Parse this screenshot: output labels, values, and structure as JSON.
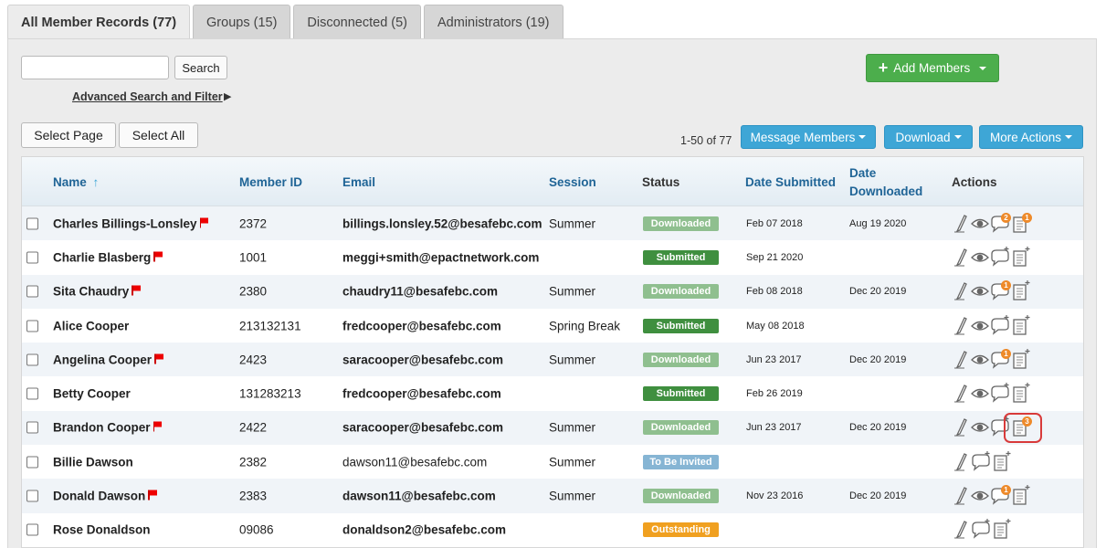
{
  "tabs": [
    {
      "label": "All Member Records (77)",
      "active": true
    },
    {
      "label": "Groups (15)",
      "active": false
    },
    {
      "label": "Disconnected (5)",
      "active": false
    },
    {
      "label": "Administrators (19)",
      "active": false
    }
  ],
  "search": {
    "value": "",
    "placeholder": "",
    "button_label": "Search",
    "advanced_link": "Advanced Search and Filter",
    "advanced_arrow": "▶"
  },
  "toolbar": {
    "add_members_label": "Add Members",
    "select_page_label": "Select Page",
    "select_all_label": "Select All",
    "count_text": "1-50 of 77",
    "message_members_label": "Message Members",
    "download_label": "Download",
    "more_actions_label": "More Actions"
  },
  "columns": {
    "name": "Name",
    "sort_arrow": "↑",
    "member_id": "Member ID",
    "email": "Email",
    "session": "Session",
    "status": "Status",
    "date_submitted": "Date Submitted",
    "date_downloaded_1": "Date",
    "date_downloaded_2": "Downloaded",
    "actions": "Actions"
  },
  "status_colors": {
    "Downloaded": "#8fbf8f",
    "Submitted": "#3f8f3f",
    "To Be Invited": "#86b5d4",
    "Outstanding": "#f0a020"
  },
  "rows": [
    {
      "name": "Charles Billings-Lonsley",
      "flag": true,
      "member_id": "2372",
      "email": "billings.lonsley.52@besafebc.com",
      "email_bold": true,
      "session": "Summer",
      "status": "Downloaded",
      "date_submitted": "Feb 07 2018",
      "date_downloaded": "Aug 19 2020",
      "view_icon": true,
      "msg_count": "2",
      "form_count": "1"
    },
    {
      "name": "Charlie Blasberg",
      "flag": true,
      "member_id": "1001",
      "email": "meggi+smith@epactnetwork.com",
      "email_bold": true,
      "session": "",
      "status": "Submitted",
      "date_submitted": "Sep 21 2020",
      "date_downloaded": "",
      "view_icon": true,
      "msg_count": "",
      "form_count": ""
    },
    {
      "name": "Sita Chaudry",
      "flag": true,
      "member_id": "2380",
      "email": "chaudry11@besafebc.com",
      "email_bold": true,
      "session": "Summer",
      "status": "Downloaded",
      "date_submitted": "Feb 08 2018",
      "date_downloaded": "Dec 20 2019",
      "view_icon": true,
      "msg_count": "1",
      "form_count": ""
    },
    {
      "name": "Alice Cooper",
      "flag": false,
      "member_id": "213132131",
      "email": "fredcooper@besafebc.com",
      "email_bold": true,
      "session": "Spring Break",
      "status": "Submitted",
      "date_submitted": "May 08 2018",
      "date_downloaded": "",
      "view_icon": true,
      "msg_count": "",
      "form_count": ""
    },
    {
      "name": "Angelina Cooper",
      "flag": true,
      "member_id": "2423",
      "email": "saracooper@besafebc.com",
      "email_bold": true,
      "session": "Summer",
      "status": "Downloaded",
      "date_submitted": "Jun 23 2017",
      "date_downloaded": "Dec 20 2019",
      "view_icon": true,
      "msg_count": "1",
      "form_count": ""
    },
    {
      "name": "Betty Cooper",
      "flag": false,
      "member_id": "131283213",
      "email": "fredcooper@besafebc.com",
      "email_bold": true,
      "session": "",
      "status": "Submitted",
      "date_submitted": "Feb 26 2019",
      "date_downloaded": "",
      "view_icon": true,
      "msg_count": "",
      "form_count": ""
    },
    {
      "name": "Brandon Cooper",
      "flag": true,
      "member_id": "2422",
      "email": "saracooper@besafebc.com",
      "email_bold": true,
      "session": "Summer",
      "status": "Downloaded",
      "date_submitted": "Jun 23 2017",
      "date_downloaded": "Dec 20 2019",
      "view_icon": true,
      "msg_count": "",
      "form_count": "3",
      "highlight": true
    },
    {
      "name": "Billie Dawson",
      "flag": false,
      "member_id": "2382",
      "email": "dawson11@besafebc.com",
      "email_bold": false,
      "session": "Summer",
      "status": "To Be Invited",
      "date_submitted": "",
      "date_downloaded": "",
      "view_icon": false,
      "msg_count": "",
      "form_count": ""
    },
    {
      "name": "Donald Dawson",
      "flag": true,
      "member_id": "2383",
      "email": "dawson11@besafebc.com",
      "email_bold": true,
      "session": "Summer",
      "status": "Downloaded",
      "date_submitted": "Nov 23 2016",
      "date_downloaded": "Dec 20 2019",
      "view_icon": true,
      "msg_count": "1",
      "form_count": ""
    },
    {
      "name": "Rose Donaldson",
      "flag": false,
      "member_id": "09086",
      "email": "donaldson2@besafebc.com",
      "email_bold": true,
      "session": "",
      "status": "Outstanding",
      "date_submitted": "",
      "date_downloaded": "",
      "view_icon": false,
      "msg_count": "",
      "form_count": ""
    }
  ]
}
